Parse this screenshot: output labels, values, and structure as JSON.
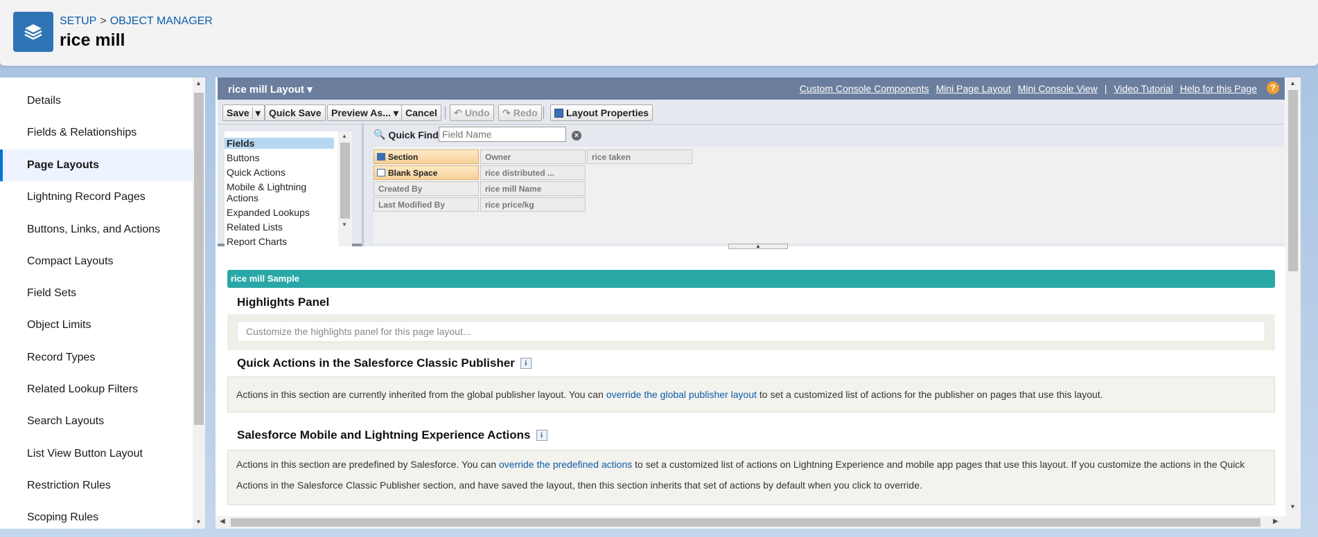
{
  "header": {
    "breadcrumb": [
      "SETUP",
      "OBJECT MANAGER"
    ],
    "breadcrumb_sep": ">",
    "object_title": "rice mill"
  },
  "sidebar": {
    "items": [
      {
        "label": "Details"
      },
      {
        "label": "Fields & Relationships"
      },
      {
        "label": "Page Layouts",
        "active": true
      },
      {
        "label": "Lightning Record Pages"
      },
      {
        "label": "Buttons, Links, and Actions"
      },
      {
        "label": "Compact Layouts"
      },
      {
        "label": "Field Sets"
      },
      {
        "label": "Object Limits"
      },
      {
        "label": "Record Types"
      },
      {
        "label": "Related Lookup Filters"
      },
      {
        "label": "Search Layouts"
      },
      {
        "label": "List View Button Layout"
      },
      {
        "label": "Restriction Rules"
      },
      {
        "label": "Scoping Rules"
      }
    ]
  },
  "layout_bar": {
    "title": "rice mill Layout",
    "links": [
      "Custom Console Components",
      "Mini Page Layout",
      "Mini Console View",
      "Video Tutorial",
      "Help for this Page"
    ],
    "pipe": "|"
  },
  "toolbar": {
    "save": "Save",
    "quick_save": "Quick Save",
    "preview_as": "Preview As...",
    "cancel": "Cancel",
    "undo": "Undo",
    "redo": "Redo",
    "layout_properties": "Layout Properties"
  },
  "palette": {
    "categories": [
      "Fields",
      "Buttons",
      "Quick Actions",
      "Mobile & Lightning Actions",
      "Expanded Lookups",
      "Related Lists",
      "Report Charts"
    ],
    "quick_find_label": "Quick Find",
    "quick_find_placeholder": "Field Name",
    "fields": {
      "col1": [
        "Section",
        "Blank Space",
        "Created By",
        "Last Modified By"
      ],
      "col2": [
        "Owner",
        "rice distributed ...",
        "rice mill Name",
        "rice price/kg"
      ],
      "col3": [
        "rice taken"
      ]
    }
  },
  "canvas": {
    "sample_title": "rice mill Sample",
    "highlights_title": "Highlights Panel",
    "highlights_placeholder": "Customize the highlights panel for this page layout...",
    "quick_actions_title": "Quick Actions in the Salesforce Classic Publisher",
    "quick_actions_text_1": "Actions in this section are currently inherited from the global publisher layout. You can ",
    "quick_actions_link": "override the global publisher layout",
    "quick_actions_text_2": " to set a customized list of actions for the publisher on pages that use this layout.",
    "mobile_title": "Salesforce Mobile and Lightning Experience Actions",
    "mobile_text_1": "Actions in this section are predefined by Salesforce. You can ",
    "mobile_link": "override the predefined actions",
    "mobile_text_2": " to set a customized list of actions on Lightning Experience and mobile app pages that use this layout. If you customize the actions in the Quick",
    "mobile_text_3": "Actions in the Salesforce Classic Publisher section, and have saved the layout, then this section inherits that set of actions by default when you click to override."
  },
  "colors": {
    "brand_blue": "#2f74b5",
    "layout_bar": "#6b7e9e",
    "sample_bar": "#2aa8a8",
    "link": "#0b5cab"
  }
}
